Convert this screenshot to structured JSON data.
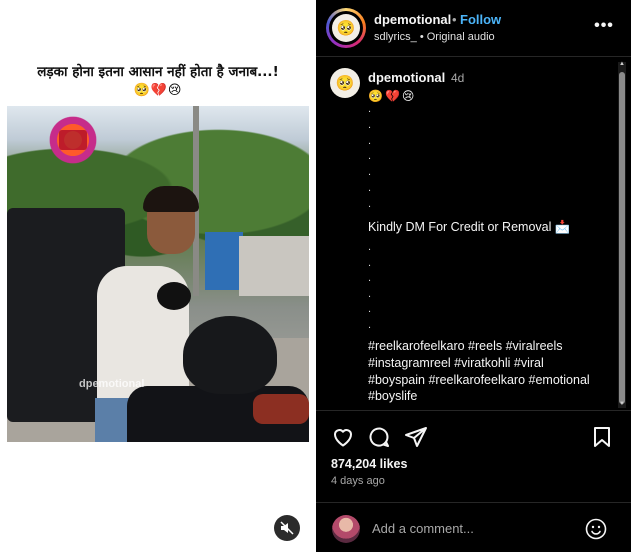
{
  "media": {
    "caption_hindi": "लड़का होना इतना आसान नहीं होता है जनाब...!",
    "caption_emoji": "🥺💔😢",
    "watermark": "dpemotional",
    "mute_icon": "speaker-muted-icon"
  },
  "header": {
    "username": "dpemotional",
    "separator": "•",
    "follow_label": "Follow",
    "audio_line": "sdlyrics_ • Original audio",
    "more_label": "•••",
    "avatar_emoji": "🥺"
  },
  "comment": {
    "username": "dpemotional",
    "time": "4d",
    "emojis": "🥺💔😢",
    "avatar_emoji": "🥺",
    "dots_top": [
      ".",
      ".",
      ".",
      ".",
      ".",
      ".",
      "."
    ],
    "credit_line": "Kindly DM For Credit or Removal 📩",
    "dots_bottom": [
      ".",
      ".",
      ".",
      ".",
      ".",
      "."
    ],
    "hashtags": "#reelkarofeelkaro #reels #viralreels #instagramreel #viratkohli #viral #boyspain #reelkarofeelkaro #emotional #boyslife"
  },
  "actions": {
    "like_icon": "heart-icon",
    "comment_icon": "comment-icon",
    "share_icon": "share-icon",
    "save_icon": "bookmark-icon",
    "likes": "874,204 likes",
    "ago": "4 days ago"
  },
  "add_comment": {
    "placeholder": "Add a comment...",
    "emoji_icon": "smiley-icon"
  },
  "colors": {
    "panel_bg": "#000000",
    "follow": "#4cb5f9",
    "muted_text": "#a8a8a8"
  }
}
